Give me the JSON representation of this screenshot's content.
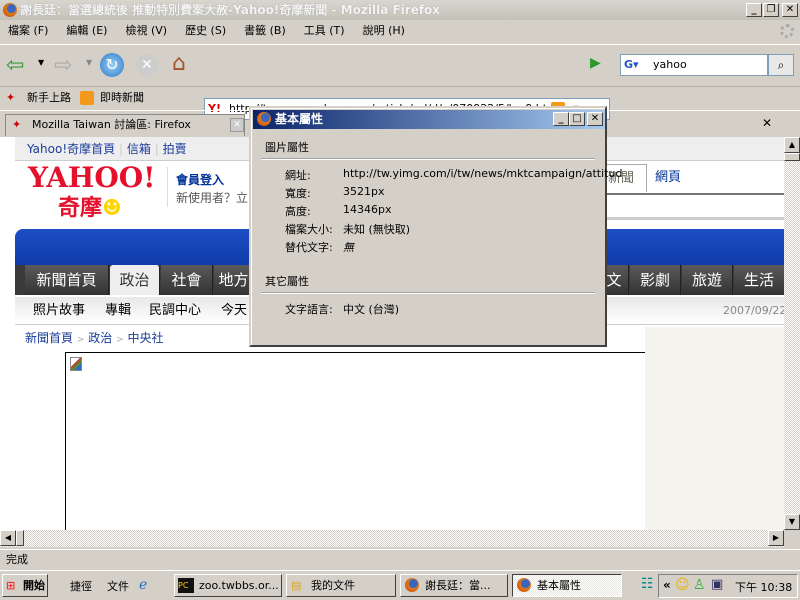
{
  "window": {
    "title": "謝長廷：當選總統後 推動特別費案大赦-Yahoo!奇摩新聞 - Mozilla Firefox"
  },
  "menu": [
    "檔案 (F)",
    "編輯 (E)",
    "檢視 (V)",
    "歷史 (S)",
    "書籤 (B)",
    "工具 (T)",
    "說明 (H)"
  ],
  "nav": {
    "url": "http://tw.news.yahoo.com/article/url/d/a/070922/5/kzr9.html",
    "search_value": "yahoo"
  },
  "bookmarks": [
    "新手上路",
    "即時新聞"
  ],
  "tabs": [
    {
      "label": "Mozilla Taiwan 討論區: Firefox"
    }
  ],
  "page": {
    "top_links": [
      "Yahoo!奇摩首頁",
      "信箱",
      "拍賣"
    ],
    "logo_text": "YAHOO!奇摩",
    "member_login": "會員登入",
    "new_user": "新使用者？立",
    "search_tabs": [
      "新聞",
      "網頁"
    ],
    "nav_tabs": [
      "新聞首頁",
      "政治",
      "社會",
      "地方",
      "文",
      "影劇",
      "旅遊",
      "生活"
    ],
    "active_tab": "政治",
    "sub_nav": [
      "照片故事",
      "專輯",
      "民調中心",
      "今天"
    ],
    "date": "2007/09/22(",
    "breadcrumb": [
      "新聞首頁",
      "政治",
      "中央社"
    ],
    "breadcrumb_sep": ">"
  },
  "dialog": {
    "title": "基本屬性",
    "section1": "圖片屬性",
    "rows": [
      {
        "label": "網址:",
        "value": "http://tw.yimg.com/i/tw/news/mktcampaign/attitud"
      },
      {
        "label": "寬度:",
        "value": "3521px"
      },
      {
        "label": "高度:",
        "value": "14346px"
      },
      {
        "label": "檔案大小:",
        "value": "未知 (無快取)"
      },
      {
        "label": "替代文字:",
        "value": "無"
      }
    ],
    "section2": "其它屬性",
    "rows2": [
      {
        "label": "文字語言:",
        "value": "中文 (台灣)"
      }
    ]
  },
  "status": "完成",
  "taskbar": {
    "start": "開始",
    "quicklaunch": [
      "捷徑",
      "文件"
    ],
    "items": [
      "zoo.twbbs.or...",
      "我的文件",
      "謝長廷：當...",
      "基本屬性"
    ],
    "clock": "下午 10:38"
  }
}
